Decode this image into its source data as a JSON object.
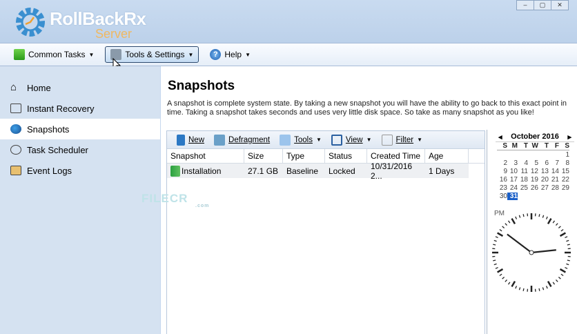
{
  "app": {
    "logo_name": "RollBackRx",
    "logo_sub": "Server",
    "window_buttons": [
      "–",
      "▢",
      "✕"
    ]
  },
  "toolbar": {
    "common_tasks": "Common Tasks",
    "tools_settings": "Tools & Settings",
    "help": "Help"
  },
  "sidebar": {
    "items": [
      {
        "label": "Home"
      },
      {
        "label": "Instant Recovery"
      },
      {
        "label": "Snapshots"
      },
      {
        "label": "Task Scheduler"
      },
      {
        "label": "Event Logs"
      }
    ],
    "selected": "Snapshots"
  },
  "main": {
    "title": "Snapshots",
    "description": "A snapshot is complete system state. By taking a new snapshot you will have the ability to go back to this exact point in time. Taking a snapshot takes seconds and uses very little disk space. So take as many snapshot as you like!"
  },
  "grid_toolbar": {
    "new": "New",
    "defragment": "Defragment",
    "tools": "Tools",
    "view": "View",
    "filter": "Filter"
  },
  "table": {
    "columns": [
      "Snapshot",
      "Size",
      "Type",
      "Status",
      "Created Time",
      "Age"
    ],
    "rows": [
      {
        "snapshot": "Installation",
        "size": "27.1 GB",
        "type": "Baseline",
        "status": "Locked",
        "created": "10/31/2016 2...",
        "age": "1 Days"
      }
    ]
  },
  "calendar": {
    "month": "October 2016",
    "prev": "◂",
    "next": "▸",
    "dow": [
      "S",
      "M",
      "T",
      "W",
      "T",
      "F",
      "S"
    ],
    "first_weekday": 6,
    "days": 31,
    "selected_day": 31
  },
  "clock": {
    "ampm": "PM",
    "time": "10:14"
  },
  "watermark": {
    "text": "FILECR",
    "sub": ".com"
  }
}
